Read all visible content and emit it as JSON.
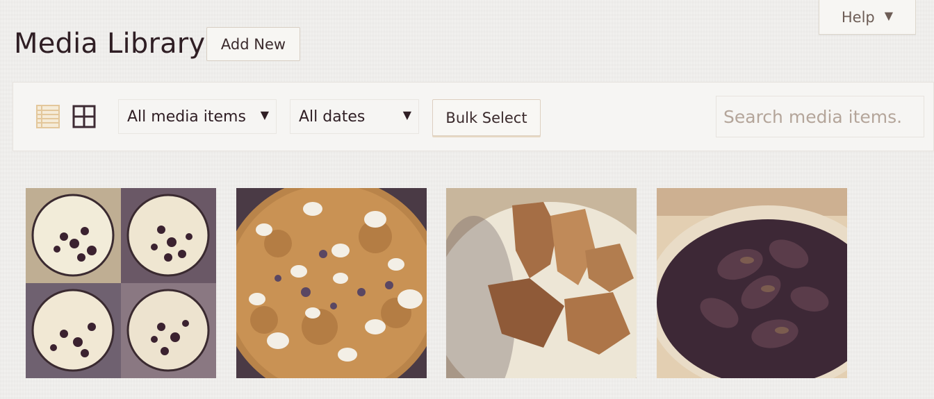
{
  "help": {
    "label": "Help",
    "arrow_icon": "triangle-down-icon"
  },
  "page": {
    "title": "Media Library",
    "add_new_label": "Add New"
  },
  "toolbar": {
    "list_view_icon": "list-view-icon",
    "grid_view_icon": "grid-view-icon",
    "media_filter": {
      "selected": "All media items"
    },
    "date_filter": {
      "selected": "All dates"
    },
    "bulk_select_label": "Bulk Select",
    "search_placeholder": "Search media items..."
  },
  "media_items": [
    {
      "kind": "four-tart-collage"
    },
    {
      "kind": "paella-pan"
    },
    {
      "kind": "fried-food-plate"
    },
    {
      "kind": "mussels-pot"
    }
  ],
  "colors": {
    "accent": "#e3c79b",
    "text_dark": "#2f1e24",
    "placeholder": "#b4a59a"
  }
}
